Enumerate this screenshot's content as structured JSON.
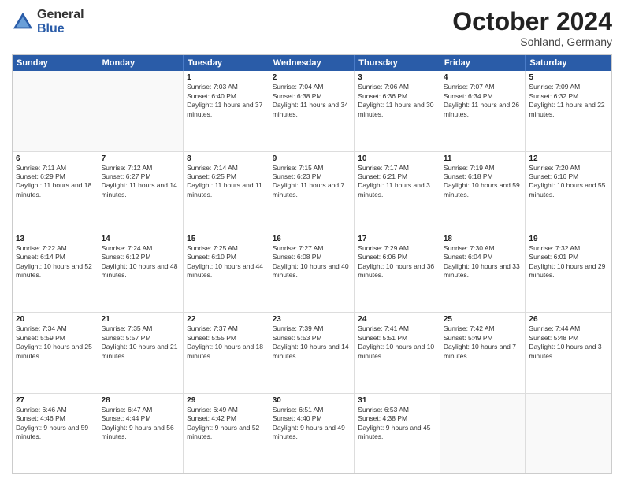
{
  "logo": {
    "general": "General",
    "blue": "Blue"
  },
  "header": {
    "month": "October 2024",
    "location": "Sohland, Germany"
  },
  "weekdays": [
    "Sunday",
    "Monday",
    "Tuesday",
    "Wednesday",
    "Thursday",
    "Friday",
    "Saturday"
  ],
  "rows": [
    [
      {
        "day": "",
        "text": "",
        "empty": true
      },
      {
        "day": "",
        "text": "",
        "empty": true
      },
      {
        "day": "1",
        "text": "Sunrise: 7:03 AM\nSunset: 6:40 PM\nDaylight: 11 hours and 37 minutes."
      },
      {
        "day": "2",
        "text": "Sunrise: 7:04 AM\nSunset: 6:38 PM\nDaylight: 11 hours and 34 minutes."
      },
      {
        "day": "3",
        "text": "Sunrise: 7:06 AM\nSunset: 6:36 PM\nDaylight: 11 hours and 30 minutes."
      },
      {
        "day": "4",
        "text": "Sunrise: 7:07 AM\nSunset: 6:34 PM\nDaylight: 11 hours and 26 minutes."
      },
      {
        "day": "5",
        "text": "Sunrise: 7:09 AM\nSunset: 6:32 PM\nDaylight: 11 hours and 22 minutes."
      }
    ],
    [
      {
        "day": "6",
        "text": "Sunrise: 7:11 AM\nSunset: 6:29 PM\nDaylight: 11 hours and 18 minutes."
      },
      {
        "day": "7",
        "text": "Sunrise: 7:12 AM\nSunset: 6:27 PM\nDaylight: 11 hours and 14 minutes."
      },
      {
        "day": "8",
        "text": "Sunrise: 7:14 AM\nSunset: 6:25 PM\nDaylight: 11 hours and 11 minutes."
      },
      {
        "day": "9",
        "text": "Sunrise: 7:15 AM\nSunset: 6:23 PM\nDaylight: 11 hours and 7 minutes."
      },
      {
        "day": "10",
        "text": "Sunrise: 7:17 AM\nSunset: 6:21 PM\nDaylight: 11 hours and 3 minutes."
      },
      {
        "day": "11",
        "text": "Sunrise: 7:19 AM\nSunset: 6:18 PM\nDaylight: 10 hours and 59 minutes."
      },
      {
        "day": "12",
        "text": "Sunrise: 7:20 AM\nSunset: 6:16 PM\nDaylight: 10 hours and 55 minutes."
      }
    ],
    [
      {
        "day": "13",
        "text": "Sunrise: 7:22 AM\nSunset: 6:14 PM\nDaylight: 10 hours and 52 minutes."
      },
      {
        "day": "14",
        "text": "Sunrise: 7:24 AM\nSunset: 6:12 PM\nDaylight: 10 hours and 48 minutes."
      },
      {
        "day": "15",
        "text": "Sunrise: 7:25 AM\nSunset: 6:10 PM\nDaylight: 10 hours and 44 minutes."
      },
      {
        "day": "16",
        "text": "Sunrise: 7:27 AM\nSunset: 6:08 PM\nDaylight: 10 hours and 40 minutes."
      },
      {
        "day": "17",
        "text": "Sunrise: 7:29 AM\nSunset: 6:06 PM\nDaylight: 10 hours and 36 minutes."
      },
      {
        "day": "18",
        "text": "Sunrise: 7:30 AM\nSunset: 6:04 PM\nDaylight: 10 hours and 33 minutes."
      },
      {
        "day": "19",
        "text": "Sunrise: 7:32 AM\nSunset: 6:01 PM\nDaylight: 10 hours and 29 minutes."
      }
    ],
    [
      {
        "day": "20",
        "text": "Sunrise: 7:34 AM\nSunset: 5:59 PM\nDaylight: 10 hours and 25 minutes."
      },
      {
        "day": "21",
        "text": "Sunrise: 7:35 AM\nSunset: 5:57 PM\nDaylight: 10 hours and 21 minutes."
      },
      {
        "day": "22",
        "text": "Sunrise: 7:37 AM\nSunset: 5:55 PM\nDaylight: 10 hours and 18 minutes."
      },
      {
        "day": "23",
        "text": "Sunrise: 7:39 AM\nSunset: 5:53 PM\nDaylight: 10 hours and 14 minutes."
      },
      {
        "day": "24",
        "text": "Sunrise: 7:41 AM\nSunset: 5:51 PM\nDaylight: 10 hours and 10 minutes."
      },
      {
        "day": "25",
        "text": "Sunrise: 7:42 AM\nSunset: 5:49 PM\nDaylight: 10 hours and 7 minutes."
      },
      {
        "day": "26",
        "text": "Sunrise: 7:44 AM\nSunset: 5:48 PM\nDaylight: 10 hours and 3 minutes."
      }
    ],
    [
      {
        "day": "27",
        "text": "Sunrise: 6:46 AM\nSunset: 4:46 PM\nDaylight: 9 hours and 59 minutes."
      },
      {
        "day": "28",
        "text": "Sunrise: 6:47 AM\nSunset: 4:44 PM\nDaylight: 9 hours and 56 minutes."
      },
      {
        "day": "29",
        "text": "Sunrise: 6:49 AM\nSunset: 4:42 PM\nDaylight: 9 hours and 52 minutes."
      },
      {
        "day": "30",
        "text": "Sunrise: 6:51 AM\nSunset: 4:40 PM\nDaylight: 9 hours and 49 minutes."
      },
      {
        "day": "31",
        "text": "Sunrise: 6:53 AM\nSunset: 4:38 PM\nDaylight: 9 hours and 45 minutes."
      },
      {
        "day": "",
        "text": "",
        "empty": true
      },
      {
        "day": "",
        "text": "",
        "empty": true
      }
    ]
  ]
}
